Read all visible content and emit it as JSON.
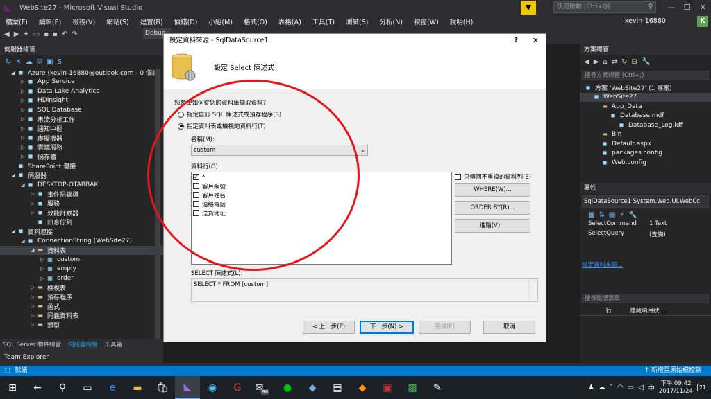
{
  "window": {
    "title": "WebSite27 - Microsoft Visual Studio",
    "quick_launch_placeholder": "快速啟動 (Ctrl+Q)",
    "user_name": "kevin-16880",
    "user_initial": "K"
  },
  "menu": [
    "檔案(F)",
    "編輯(E)",
    "檢視(V)",
    "網站(S)",
    "建置(B)",
    "偵錯(D)",
    "小組(M)",
    "格式(O)",
    "表格(A)",
    "工具(T)",
    "測試(S)",
    "分析(N)",
    "視窗(W)",
    "說明(H)"
  ],
  "toolbar": {
    "debug_label": "Debug"
  },
  "server_explorer": {
    "title": "伺服器總管",
    "tree": [
      {
        "label": "Azure (kevin-16880@outlook.com - 0 個訂",
        "indent": 1,
        "expanded": true,
        "icon": "azure-icon"
      },
      {
        "label": "App Service",
        "indent": 2,
        "expanded": false,
        "icon": "globe-icon"
      },
      {
        "label": "Data Lake Analytics",
        "indent": 2,
        "expanded": false,
        "icon": "datalake-icon"
      },
      {
        "label": "HDInsight",
        "indent": 2,
        "expanded": false,
        "icon": "hdinsight-icon"
      },
      {
        "label": "SQL Database",
        "indent": 2,
        "expanded": false,
        "icon": "sql-icon"
      },
      {
        "label": "串流分析工作",
        "indent": 2,
        "expanded": false,
        "icon": "stream-icon"
      },
      {
        "label": "通知中樞",
        "indent": 2,
        "expanded": false,
        "icon": "notify-icon"
      },
      {
        "label": "虛擬機器",
        "indent": 2,
        "expanded": false,
        "icon": "vm-icon"
      },
      {
        "label": "雲端服務",
        "indent": 2,
        "expanded": false,
        "icon": "cloud-icon"
      },
      {
        "label": "儲存體",
        "indent": 2,
        "expanded": false,
        "icon": "storage-icon"
      },
      {
        "label": "SharePoint 連接",
        "indent": 1,
        "expanded": null,
        "icon": "sharepoint-icon"
      },
      {
        "label": "伺服器",
        "indent": 1,
        "expanded": true,
        "icon": "server-icon"
      },
      {
        "label": "DESKTOP-OTABBAK",
        "indent": 2,
        "expanded": true,
        "icon": "computer-icon"
      },
      {
        "label": "事件記錄檔",
        "indent": 3,
        "expanded": false,
        "icon": "eventlog-icon"
      },
      {
        "label": "服務",
        "indent": 3,
        "expanded": false,
        "icon": "service-icon"
      },
      {
        "label": "效能計數器",
        "indent": 3,
        "expanded": false,
        "icon": "perf-icon"
      },
      {
        "label": "訊息佇列",
        "indent": 3,
        "expanded": null,
        "icon": "queue-icon"
      },
      {
        "label": "資料連接",
        "indent": 1,
        "expanded": true,
        "icon": "dataconn-icon"
      },
      {
        "label": "ConnectionString (WebSite27)",
        "indent": 2,
        "expanded": true,
        "icon": "connection-icon"
      },
      {
        "label": "資料表",
        "indent": 3,
        "expanded": true,
        "icon": "folder-icon",
        "selected": true
      },
      {
        "label": "custom",
        "indent": 4,
        "expanded": false,
        "icon": "table-icon"
      },
      {
        "label": "emply",
        "indent": 4,
        "expanded": false,
        "icon": "table-icon"
      },
      {
        "label": "order",
        "indent": 4,
        "expanded": false,
        "icon": "table-icon"
      },
      {
        "label": "檢視表",
        "indent": 3,
        "expanded": false,
        "icon": "folder-icon"
      },
      {
        "label": "預存程序",
        "indent": 3,
        "expanded": false,
        "icon": "folder-icon"
      },
      {
        "label": "函式",
        "indent": 3,
        "expanded": false,
        "icon": "folder-icon"
      },
      {
        "label": "同義資料表",
        "indent": 3,
        "expanded": false,
        "icon": "folder-icon"
      },
      {
        "label": "類型",
        "indent": 3,
        "expanded": false,
        "icon": "folder-icon"
      }
    ],
    "tabs": [
      "SQL Server 物件總管",
      "伺服器總管",
      "工具箱"
    ],
    "active_tab": 1,
    "team_explorer": "Team Explorer"
  },
  "solution_explorer": {
    "title": "方案總管",
    "search_placeholder": "搜尋方案總管 (Ctrl+;)",
    "tree": [
      {
        "label": "方案 'WebSite27' (1 專案)",
        "indent": 0,
        "icon": "solution-icon"
      },
      {
        "label": "WebSite27",
        "indent": 1,
        "icon": "website-icon",
        "selected": true
      },
      {
        "label": "App_Data",
        "indent": 2,
        "icon": "folder-icon"
      },
      {
        "label": "Database.mdf",
        "indent": 3,
        "icon": "database-icon"
      },
      {
        "label": "Database_Log.ldf",
        "indent": 4,
        "icon": "file-icon"
      },
      {
        "label": "Bin",
        "indent": 2,
        "icon": "folder-icon"
      },
      {
        "label": "Default.aspx",
        "indent": 2,
        "icon": "aspx-icon"
      },
      {
        "label": "packages.config",
        "indent": 2,
        "icon": "config-icon"
      },
      {
        "label": "Web.config",
        "indent": 2,
        "icon": "config-icon"
      }
    ]
  },
  "properties": {
    "title": "屬性",
    "selector": "SqlDataSource1  System.Web.UI.WebCc",
    "rows": [
      {
        "name": "SelectCommand",
        "value": "1 Text"
      },
      {
        "name": "SelectQuery",
        "value": "(查詢)"
      }
    ],
    "link": "設定資料來源..."
  },
  "error_list": {
    "title": "搜尋錯誤清單",
    "col_line": "行",
    "col_suppress": "隱藏項目狀..."
  },
  "dialog": {
    "title": "設定資料來源 - SqlDataSource1",
    "help": "?",
    "heading": "設定 Select 陳述式",
    "question": "您希望如何從您的資料庫擷取資料?",
    "option_custom": "指定自訂 SQL 陳述式或預存程序(S)",
    "option_table": "指定資料表或檢視的資料行(T)",
    "name_label": "名稱(M):",
    "name_value": "custom",
    "columns_label": "資料行(O):",
    "columns": [
      {
        "label": "*",
        "checked": true
      },
      {
        "label": "客戶編號",
        "checked": false
      },
      {
        "label": "客戶姓名",
        "checked": false
      },
      {
        "label": "連絡電話",
        "checked": false
      },
      {
        "label": "送貨地址",
        "checked": false
      }
    ],
    "distinct_label": "只傳回不重複的資料列(E)",
    "where_btn": "WHERE(W)...",
    "orderby_btn": "ORDER BY(R)...",
    "advanced_btn": "進階(V)...",
    "sql_label": "SELECT 陳述式(L):",
    "sql_value": "SELECT * FROM [custom]",
    "prev_btn": "< 上一步(P)",
    "next_btn": "下一步(N) >",
    "finish_btn": "完成(F)",
    "cancel_btn": "取消"
  },
  "statusbar": {
    "left": "就緒",
    "right": "新增至原始檔控制"
  },
  "taskbar": {
    "time": "下午 09:42",
    "date": "2017/11/24",
    "notifications": "21",
    "mail_badge": "86",
    "lang": "中"
  }
}
